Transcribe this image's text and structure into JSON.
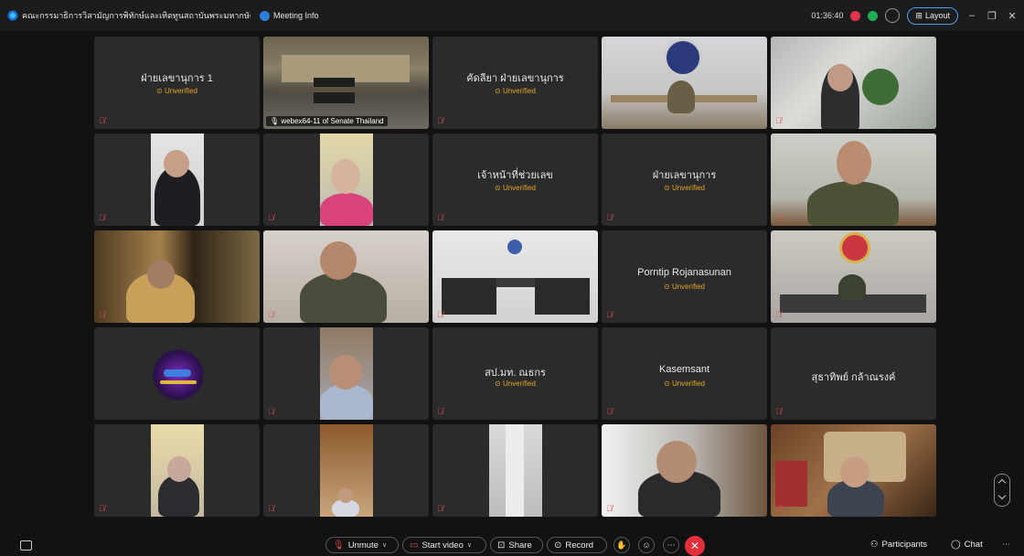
{
  "topbar": {
    "title": "คณะกรรมาธิการวิสามัญการพิทักษ์และเทิดทูนสถาบันพระมหากษัตริย์ วุฒิสภา",
    "meeting_info": "Meeting Info",
    "timer": "01:36:40",
    "layout": "Layout"
  },
  "tiles": [
    {
      "name": "ฝ่ายเลขานุการ 1",
      "status": "Unverified",
      "type": "name"
    },
    {
      "label": "webex64-11 of  Senate Thailand",
      "type": "video",
      "scene": "room"
    },
    {
      "name": "คัดลียา ฝ่ายเลขานุการ",
      "status": "Unverified",
      "type": "name"
    },
    {
      "type": "video",
      "scene": "officer"
    },
    {
      "type": "video",
      "scene": "elder"
    },
    {
      "type": "video",
      "scene": "lady1"
    },
    {
      "type": "video",
      "scene": "lady2"
    },
    {
      "name": "เจ้าหน้าที่ช่วยเลข",
      "status": "Unverified",
      "type": "name"
    },
    {
      "name": "ฝ่ายเลขานุการ",
      "status": "Unverified",
      "type": "name"
    },
    {
      "type": "video",
      "scene": "soldier"
    },
    {
      "type": "video",
      "scene": "golden"
    },
    {
      "type": "video",
      "scene": "police"
    },
    {
      "type": "video",
      "scene": "meetingroom"
    },
    {
      "name": "Porntip Rojanasunan",
      "status": "Unverified",
      "type": "name"
    },
    {
      "type": "video",
      "scene": "redroom"
    },
    {
      "type": "logo"
    },
    {
      "type": "video",
      "scene": "oldman"
    },
    {
      "name": "สป.มท. ณธกร",
      "status": "Unverified",
      "type": "name"
    },
    {
      "name": "Kasemsant",
      "status": "Unverified",
      "type": "name"
    },
    {
      "name": "สุธาทิพย์ กล้าณรงค์",
      "status": "",
      "type": "name"
    },
    {
      "type": "video",
      "scene": "suit"
    },
    {
      "type": "video",
      "scene": "seated"
    },
    {
      "type": "video",
      "scene": "door"
    },
    {
      "type": "video",
      "scene": "glasses"
    },
    {
      "type": "video",
      "scene": "map"
    }
  ],
  "toolbar": {
    "unmute": "Unmute",
    "start_video": "Start video",
    "share": "Share",
    "record": "Record",
    "participants": "Participants",
    "chat": "Chat"
  },
  "colors": {
    "accent": "#4aa0ff",
    "unverified": "#e6a524",
    "end": "#e1303c",
    "active_border": "#2fb36e"
  }
}
